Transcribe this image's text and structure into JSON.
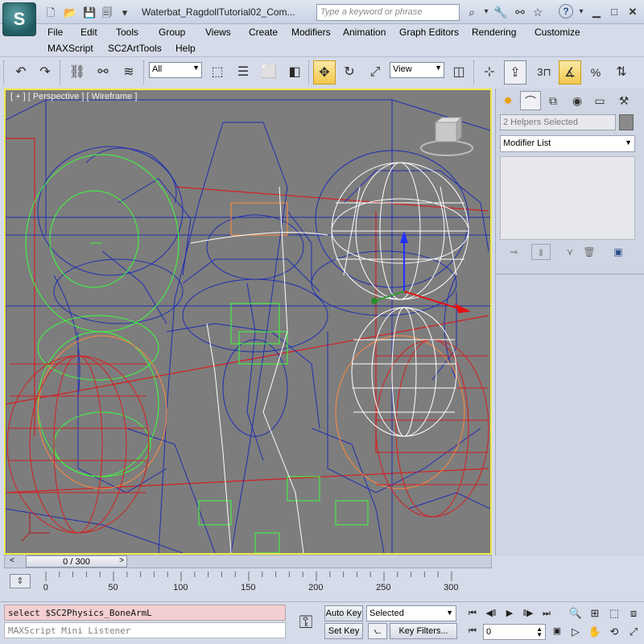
{
  "window": {
    "title": "Waterbat_RagdollTutorial02_Com...",
    "search_placeholder": "Type a keyword or phrase",
    "logo_glyph": "S"
  },
  "menus": [
    "File",
    "Edit",
    "Tools",
    "Group",
    "Views",
    "Create",
    "Modifiers",
    "Animation",
    "Graph Editors",
    "Rendering",
    "Customize",
    "MAXScript",
    "SC2ArtTools",
    "Help"
  ],
  "toolbar": {
    "selection_filter": "All",
    "reference_coord": "View",
    "snap_label": "3"
  },
  "viewport": {
    "label": "[ + ] [ Perspective ] [ Wireframe ]"
  },
  "command_panel": {
    "selection_text": "2 Helpers Selected",
    "modifier_list": "Modifier List"
  },
  "timeline": {
    "frame_readout": "0 / 300",
    "current_frame": 0,
    "total_frames": 300,
    "ruler_labels": [
      "0",
      "50",
      "100",
      "150",
      "200",
      "250",
      "300"
    ]
  },
  "bottom": {
    "maxscript_input": "select $SC2Physics_BoneArmL",
    "maxscript_listener": "MAXScript Mini Listener",
    "auto_key": "Auto Key",
    "set_key": "Set Key",
    "key_mode": "Selected",
    "key_filters": "Key Filters...",
    "frame_field": "0"
  },
  "colors": {
    "viewport_border": "#f2e84a",
    "viewport_bg": "#7d7d7d",
    "wire_blue": "#1f2fb0",
    "wire_green": "#3cff3c",
    "wire_red": "#d42020",
    "wire_orange": "#ff8a3c",
    "wire_white": "#ffffff",
    "maxscript_input_bg": "#f3cfd2"
  }
}
